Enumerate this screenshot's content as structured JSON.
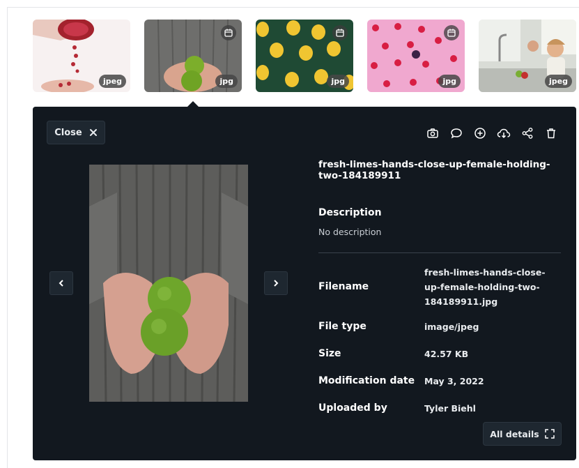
{
  "thumbnails": [
    {
      "badge": "jpeg",
      "calendar": false
    },
    {
      "badge": "jpg",
      "calendar": true
    },
    {
      "badge": "jpg",
      "calendar": true
    },
    {
      "badge": "jpg",
      "calendar": true
    },
    {
      "badge": "jpeg",
      "calendar": false
    }
  ],
  "panel": {
    "close_label": "Close",
    "toolbar_icons": [
      "camera-icon",
      "comment-icon",
      "add-circle-icon",
      "cloud-download-icon",
      "share-icon",
      "trash-icon"
    ],
    "title": "fresh-limes-hands-close-up-female-holding-two-184189911",
    "description_heading": "Description",
    "description_value": "No description",
    "details": {
      "filename_label": "Filename",
      "filename_value": "fresh-limes-hands-close-up-female-holding-two-184189911.jpg",
      "filetype_label": "File type",
      "filetype_value": "image/jpeg",
      "size_label": "Size",
      "size_value": "42.57 KB",
      "moddate_label": "Modification date",
      "moddate_value": "May 3, 2022",
      "uploadedby_label": "Uploaded by",
      "uploadedby_value": "Tyler Biehl"
    },
    "all_details_label": "All details"
  },
  "colors": {
    "panel_bg": "#12181f",
    "button_bg": "#1e2730"
  }
}
